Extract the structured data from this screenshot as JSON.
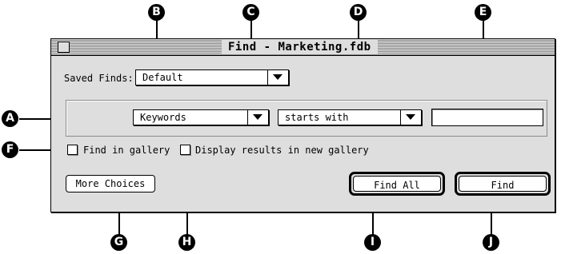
{
  "window": {
    "title": "Find - Marketing.fdb"
  },
  "saved_finds": {
    "label": "Saved Finds:",
    "value": "Default"
  },
  "criteria": {
    "field": "Keywords",
    "operator": "starts with",
    "value": ""
  },
  "options": {
    "find_in_gallery": {
      "label": "Find in gallery",
      "checked": false
    },
    "display_new_gallery": {
      "label": "Display results in new gallery",
      "checked": false
    }
  },
  "buttons": {
    "more_choices": "More Choices",
    "find_all": "Find All",
    "find": "Find"
  },
  "callouts": {
    "a": "A",
    "b": "B",
    "c": "C",
    "d": "D",
    "e": "E",
    "f": "F",
    "g": "G",
    "h": "H",
    "i": "I",
    "j": "J"
  }
}
